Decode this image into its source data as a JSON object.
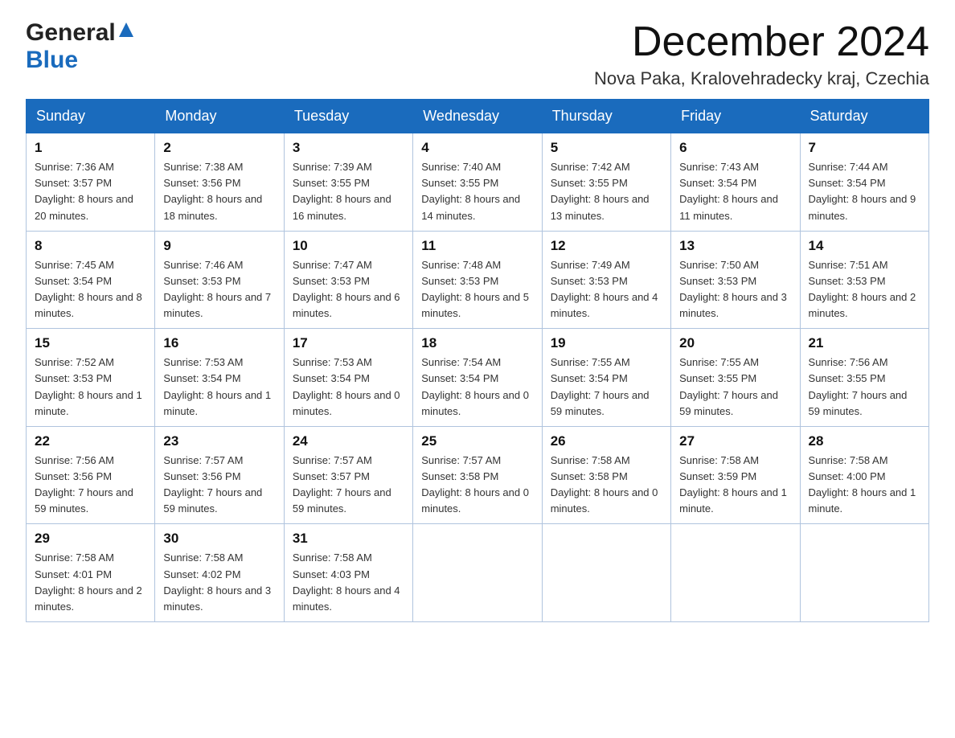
{
  "header": {
    "logo_general": "General",
    "logo_blue": "Blue",
    "title": "December 2024",
    "location": "Nova Paka, Kralovehradecky kraj, Czechia"
  },
  "weekdays": [
    "Sunday",
    "Monday",
    "Tuesday",
    "Wednesday",
    "Thursday",
    "Friday",
    "Saturday"
  ],
  "weeks": [
    [
      {
        "day": "1",
        "sunrise": "7:36 AM",
        "sunset": "3:57 PM",
        "daylight": "8 hours and 20 minutes."
      },
      {
        "day": "2",
        "sunrise": "7:38 AM",
        "sunset": "3:56 PM",
        "daylight": "8 hours and 18 minutes."
      },
      {
        "day": "3",
        "sunrise": "7:39 AM",
        "sunset": "3:55 PM",
        "daylight": "8 hours and 16 minutes."
      },
      {
        "day": "4",
        "sunrise": "7:40 AM",
        "sunset": "3:55 PM",
        "daylight": "8 hours and 14 minutes."
      },
      {
        "day": "5",
        "sunrise": "7:42 AM",
        "sunset": "3:55 PM",
        "daylight": "8 hours and 13 minutes."
      },
      {
        "day": "6",
        "sunrise": "7:43 AM",
        "sunset": "3:54 PM",
        "daylight": "8 hours and 11 minutes."
      },
      {
        "day": "7",
        "sunrise": "7:44 AM",
        "sunset": "3:54 PM",
        "daylight": "8 hours and 9 minutes."
      }
    ],
    [
      {
        "day": "8",
        "sunrise": "7:45 AM",
        "sunset": "3:54 PM",
        "daylight": "8 hours and 8 minutes."
      },
      {
        "day": "9",
        "sunrise": "7:46 AM",
        "sunset": "3:53 PM",
        "daylight": "8 hours and 7 minutes."
      },
      {
        "day": "10",
        "sunrise": "7:47 AM",
        "sunset": "3:53 PM",
        "daylight": "8 hours and 6 minutes."
      },
      {
        "day": "11",
        "sunrise": "7:48 AM",
        "sunset": "3:53 PM",
        "daylight": "8 hours and 5 minutes."
      },
      {
        "day": "12",
        "sunrise": "7:49 AM",
        "sunset": "3:53 PM",
        "daylight": "8 hours and 4 minutes."
      },
      {
        "day": "13",
        "sunrise": "7:50 AM",
        "sunset": "3:53 PM",
        "daylight": "8 hours and 3 minutes."
      },
      {
        "day": "14",
        "sunrise": "7:51 AM",
        "sunset": "3:53 PM",
        "daylight": "8 hours and 2 minutes."
      }
    ],
    [
      {
        "day": "15",
        "sunrise": "7:52 AM",
        "sunset": "3:53 PM",
        "daylight": "8 hours and 1 minute."
      },
      {
        "day": "16",
        "sunrise": "7:53 AM",
        "sunset": "3:54 PM",
        "daylight": "8 hours and 1 minute."
      },
      {
        "day": "17",
        "sunrise": "7:53 AM",
        "sunset": "3:54 PM",
        "daylight": "8 hours and 0 minutes."
      },
      {
        "day": "18",
        "sunrise": "7:54 AM",
        "sunset": "3:54 PM",
        "daylight": "8 hours and 0 minutes."
      },
      {
        "day": "19",
        "sunrise": "7:55 AM",
        "sunset": "3:54 PM",
        "daylight": "7 hours and 59 minutes."
      },
      {
        "day": "20",
        "sunrise": "7:55 AM",
        "sunset": "3:55 PM",
        "daylight": "7 hours and 59 minutes."
      },
      {
        "day": "21",
        "sunrise": "7:56 AM",
        "sunset": "3:55 PM",
        "daylight": "7 hours and 59 minutes."
      }
    ],
    [
      {
        "day": "22",
        "sunrise": "7:56 AM",
        "sunset": "3:56 PM",
        "daylight": "7 hours and 59 minutes."
      },
      {
        "day": "23",
        "sunrise": "7:57 AM",
        "sunset": "3:56 PM",
        "daylight": "7 hours and 59 minutes."
      },
      {
        "day": "24",
        "sunrise": "7:57 AM",
        "sunset": "3:57 PM",
        "daylight": "7 hours and 59 minutes."
      },
      {
        "day": "25",
        "sunrise": "7:57 AM",
        "sunset": "3:58 PM",
        "daylight": "8 hours and 0 minutes."
      },
      {
        "day": "26",
        "sunrise": "7:58 AM",
        "sunset": "3:58 PM",
        "daylight": "8 hours and 0 minutes."
      },
      {
        "day": "27",
        "sunrise": "7:58 AM",
        "sunset": "3:59 PM",
        "daylight": "8 hours and 1 minute."
      },
      {
        "day": "28",
        "sunrise": "7:58 AM",
        "sunset": "4:00 PM",
        "daylight": "8 hours and 1 minute."
      }
    ],
    [
      {
        "day": "29",
        "sunrise": "7:58 AM",
        "sunset": "4:01 PM",
        "daylight": "8 hours and 2 minutes."
      },
      {
        "day": "30",
        "sunrise": "7:58 AM",
        "sunset": "4:02 PM",
        "daylight": "8 hours and 3 minutes."
      },
      {
        "day": "31",
        "sunrise": "7:58 AM",
        "sunset": "4:03 PM",
        "daylight": "8 hours and 4 minutes."
      },
      null,
      null,
      null,
      null
    ]
  ],
  "labels": {
    "sunrise": "Sunrise:",
    "sunset": "Sunset:",
    "daylight": "Daylight:"
  }
}
